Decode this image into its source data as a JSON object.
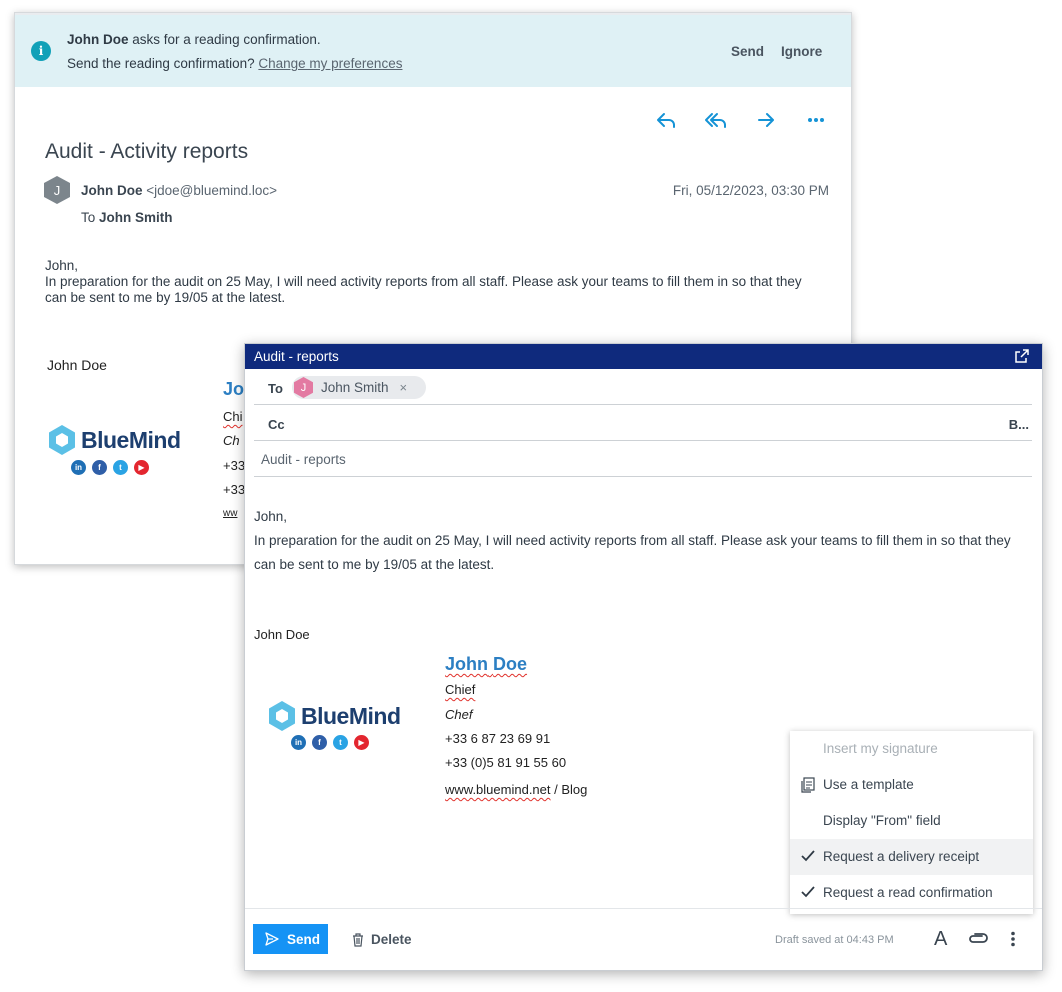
{
  "banner": {
    "sender": "John Doe",
    "request_text": " asks for a reading confirmation.",
    "question": "Send the reading confirmation? ",
    "preferences_link": "Change my preferences",
    "send_label": "Send",
    "ignore_label": "Ignore"
  },
  "message": {
    "subject": "Audit - Activity reports",
    "avatar_letter": "J",
    "from_name": "John Doe",
    "from_email": " <jdoe@bluemind.loc>",
    "to_prefix": "To ",
    "to_name": "John Smith",
    "date": "Fri, 05/12/2023, 03:30 PM",
    "body_greeting": "John,",
    "body_text": "In preparation for the audit on 25 May, I will need activity reports from all staff. Please ask your teams to fill them in so that they can be sent to me by 19/05 at the latest.",
    "signature_name": "John Doe",
    "sig_partial": [
      "Jo",
      "Chi",
      "Ch",
      "+33",
      "+33",
      "ww"
    ]
  },
  "logo": {
    "text": "BlueMind"
  },
  "socials": [
    "in",
    "f",
    "t",
    "▶"
  ],
  "compose": {
    "title": "Audit - reports",
    "to_label": "To",
    "recipient_letter": "J",
    "recipient_name": "John Smith",
    "recipient_remove": "×",
    "cc_label": "Cc",
    "bcc_label": "B...",
    "subject": "Audit - reports",
    "body_greeting": "John,",
    "body_text": "In preparation for the audit on 25 May, I will need activity reports from all staff. Please ask your teams to fill them in so that they can be sent to me by 19/05 at the latest.",
    "signature_name": "John Doe",
    "sig": {
      "first": "John",
      "last": "Doe",
      "title1": "Chief",
      "title2": "Chef",
      "phone1": "+33 6 87 23 69 91",
      "phone2": "+33 (0)5 81 91 55 60",
      "website": "www.bluemind.net",
      "sep": " / ",
      "blog": "Blog"
    },
    "send_label": "Send",
    "delete_label": "Delete",
    "draft_status": "Draft saved at 04:43 PM",
    "text_format_label": "A"
  },
  "menu": {
    "items": [
      {
        "label": "Insert my signature",
        "state": "disabled"
      },
      {
        "label": "Use a template",
        "icon": "template-icon"
      },
      {
        "label": "Display \"From\" field"
      },
      {
        "label": "Request a delivery receipt",
        "checked": true
      },
      {
        "label": "Request a read confirmation",
        "checked": true
      }
    ]
  },
  "colors": {
    "accent": "#1593d6",
    "compose_bar": "#0f2a7d",
    "banner_bg": "#dff1f5",
    "send_button": "#1593f5"
  }
}
